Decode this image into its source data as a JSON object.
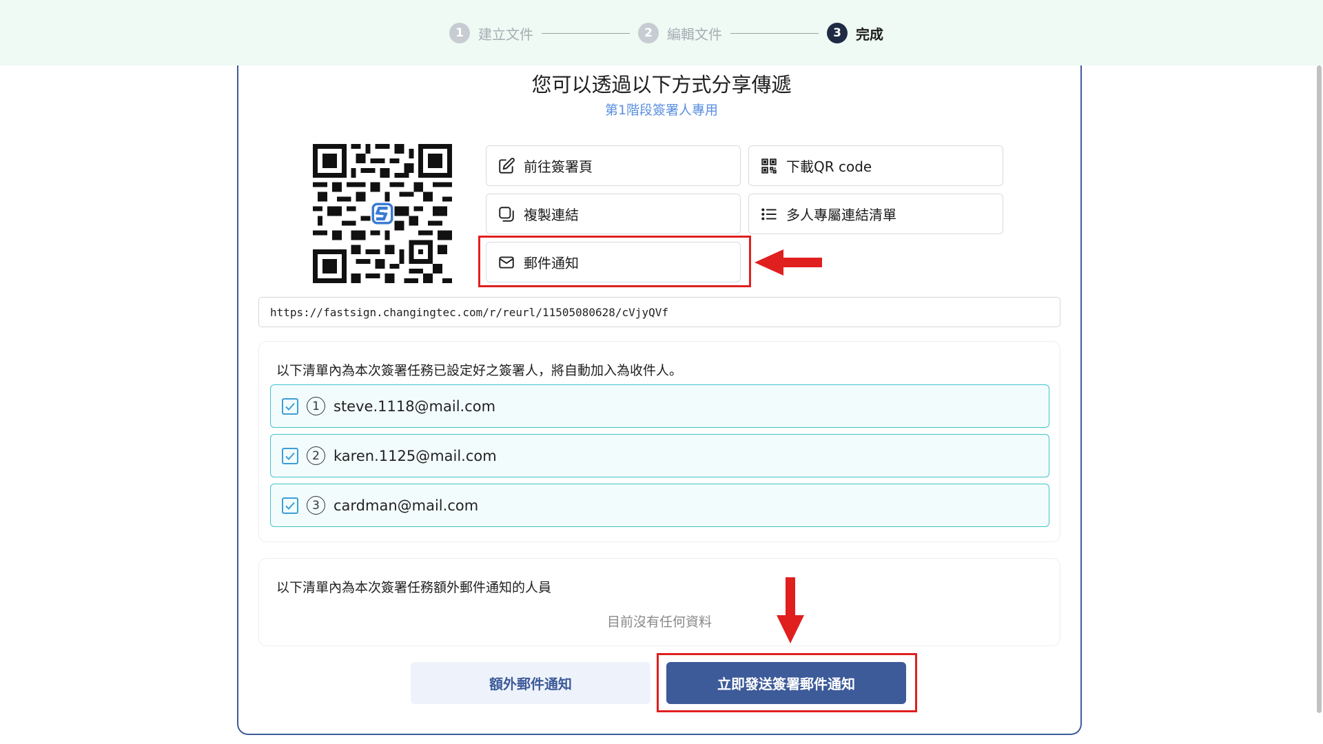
{
  "stepper": {
    "steps": [
      {
        "num": "1",
        "label": "建立文件"
      },
      {
        "num": "2",
        "label": "編輯文件"
      },
      {
        "num": "3",
        "label": "完成"
      }
    ]
  },
  "main": {
    "title": "您可以透過以下方式分享傳遞",
    "subtitle": "第1階段簽署人專用"
  },
  "actions": {
    "go_sign": "前往簽署頁",
    "download_qr": "下載QR code",
    "copy_link": "複製連結",
    "multi_links": "多人專屬連結清單",
    "email_notify": "郵件通知"
  },
  "share_url": "https://fastsign.changingtec.com/r/reurl/11505080628/cVjyQVf",
  "signers_panel": {
    "title": "以下清單內為本次簽署任務已設定好之簽署人，將自動加入為收件人。",
    "recipients": [
      {
        "num": "1",
        "email": "steve.1118@mail.com"
      },
      {
        "num": "2",
        "email": "karen.1125@mail.com"
      },
      {
        "num": "3",
        "email": "cardman@mail.com"
      }
    ]
  },
  "extra_panel": {
    "title": "以下清單內為本次簽署任務額外郵件通知的人員",
    "empty_text": "目前沒有任何資料"
  },
  "buttons": {
    "extra_notify": "額外郵件通知",
    "send_now": "立即發送簽署郵件通知"
  },
  "colors": {
    "primary": "#3d5a99",
    "accent_teal": "#3fc3c9",
    "annotation_red": "#e01f1f",
    "topbar_bg": "#eefaf3"
  },
  "icons": {
    "go_sign": "edit-icon",
    "download_qr": "qr-code-icon",
    "copy_link": "copy-icon",
    "multi_links": "list-icon",
    "email_notify": "mail-icon"
  }
}
